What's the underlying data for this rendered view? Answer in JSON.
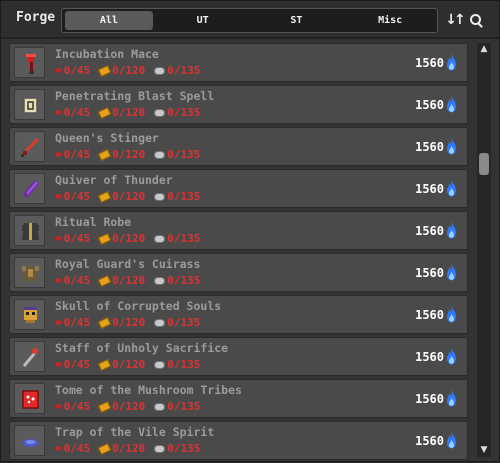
{
  "header": {
    "title": "Forge",
    "tabs": [
      {
        "label": "All",
        "active": true
      },
      {
        "label": "UT",
        "active": false
      },
      {
        "label": "ST",
        "active": false
      },
      {
        "label": "Misc",
        "active": false
      }
    ],
    "sort_icon": "sort-arrows-icon",
    "search_icon": "search-icon"
  },
  "items": [
    {
      "name": "Incubation Mace",
      "life": "0/45",
      "gold": "0/120",
      "fiber": "0/135",
      "price": "1560",
      "icon": "mace-icon"
    },
    {
      "name": "Penetrating Blast Spell",
      "life": "0/45",
      "gold": "0/120",
      "fiber": "0/135",
      "price": "1560",
      "icon": "spell-icon"
    },
    {
      "name": "Queen's Stinger",
      "life": "0/45",
      "gold": "0/120",
      "fiber": "0/135",
      "price": "1560",
      "icon": "dagger-icon"
    },
    {
      "name": "Quiver of Thunder",
      "life": "0/45",
      "gold": "0/120",
      "fiber": "0/135",
      "price": "1560",
      "icon": "quiver-icon"
    },
    {
      "name": "Ritual Robe",
      "life": "0/45",
      "gold": "0/120",
      "fiber": "0/135",
      "price": "1560",
      "icon": "robe-icon"
    },
    {
      "name": "Royal Guard's Cuirass",
      "life": "0/45",
      "gold": "0/120",
      "fiber": "0/135",
      "price": "1560",
      "icon": "cuirass-icon"
    },
    {
      "name": "Skull of Corrupted Souls",
      "life": "0/45",
      "gold": "0/120",
      "fiber": "0/135",
      "price": "1560",
      "icon": "skull-icon"
    },
    {
      "name": "Staff of Unholy Sacrifice",
      "life": "0/45",
      "gold": "0/120",
      "fiber": "0/135",
      "price": "1560",
      "icon": "staff-icon"
    },
    {
      "name": "Tome of the Mushroom Tribes",
      "life": "0/45",
      "gold": "0/120",
      "fiber": "0/135",
      "price": "1560",
      "icon": "tome-icon"
    },
    {
      "name": "Trap of the Vile Spirit",
      "life": "0/45",
      "gold": "0/120",
      "fiber": "0/135",
      "price": "1560",
      "icon": "trap-icon"
    }
  ],
  "colors": {
    "cost_red": "#dd3232",
    "name_gray": "#9b9b9b",
    "flame_blue": "#2f7bff",
    "row_bg": "#4a4a4a"
  }
}
